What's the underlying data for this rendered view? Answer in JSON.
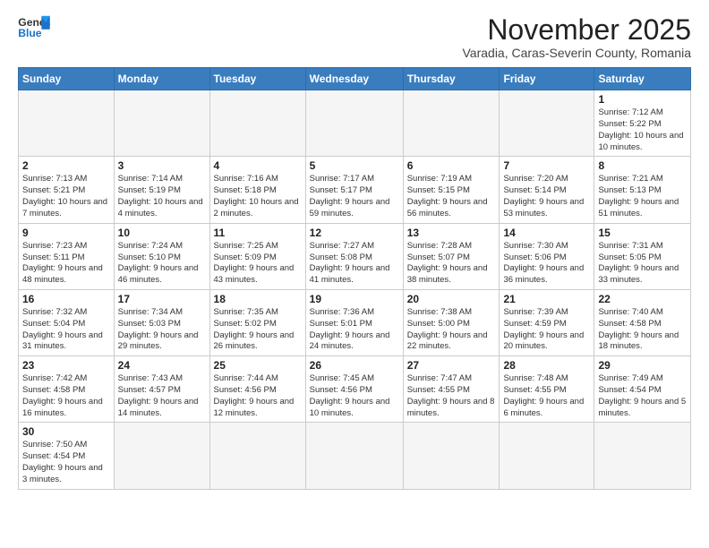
{
  "logo": {
    "line1": "General",
    "line2": "Blue"
  },
  "title": "November 2025",
  "subtitle": "Varadia, Caras-Severin County, Romania",
  "days_of_week": [
    "Sunday",
    "Monday",
    "Tuesday",
    "Wednesday",
    "Thursday",
    "Friday",
    "Saturday"
  ],
  "weeks": [
    [
      {
        "num": "",
        "info": "",
        "empty": true
      },
      {
        "num": "",
        "info": "",
        "empty": true
      },
      {
        "num": "",
        "info": "",
        "empty": true
      },
      {
        "num": "",
        "info": "",
        "empty": true
      },
      {
        "num": "",
        "info": "",
        "empty": true
      },
      {
        "num": "",
        "info": "",
        "empty": true
      },
      {
        "num": "1",
        "info": "Sunrise: 7:12 AM\nSunset: 5:22 PM\nDaylight: 10 hours\nand 10 minutes.",
        "empty": false
      }
    ],
    [
      {
        "num": "2",
        "info": "Sunrise: 7:13 AM\nSunset: 5:21 PM\nDaylight: 10 hours\nand 7 minutes.",
        "empty": false
      },
      {
        "num": "3",
        "info": "Sunrise: 7:14 AM\nSunset: 5:19 PM\nDaylight: 10 hours\nand 4 minutes.",
        "empty": false
      },
      {
        "num": "4",
        "info": "Sunrise: 7:16 AM\nSunset: 5:18 PM\nDaylight: 10 hours\nand 2 minutes.",
        "empty": false
      },
      {
        "num": "5",
        "info": "Sunrise: 7:17 AM\nSunset: 5:17 PM\nDaylight: 9 hours\nand 59 minutes.",
        "empty": false
      },
      {
        "num": "6",
        "info": "Sunrise: 7:19 AM\nSunset: 5:15 PM\nDaylight: 9 hours\nand 56 minutes.",
        "empty": false
      },
      {
        "num": "7",
        "info": "Sunrise: 7:20 AM\nSunset: 5:14 PM\nDaylight: 9 hours\nand 53 minutes.",
        "empty": false
      },
      {
        "num": "8",
        "info": "Sunrise: 7:21 AM\nSunset: 5:13 PM\nDaylight: 9 hours\nand 51 minutes.",
        "empty": false
      }
    ],
    [
      {
        "num": "9",
        "info": "Sunrise: 7:23 AM\nSunset: 5:11 PM\nDaylight: 9 hours\nand 48 minutes.",
        "empty": false
      },
      {
        "num": "10",
        "info": "Sunrise: 7:24 AM\nSunset: 5:10 PM\nDaylight: 9 hours\nand 46 minutes.",
        "empty": false
      },
      {
        "num": "11",
        "info": "Sunrise: 7:25 AM\nSunset: 5:09 PM\nDaylight: 9 hours\nand 43 minutes.",
        "empty": false
      },
      {
        "num": "12",
        "info": "Sunrise: 7:27 AM\nSunset: 5:08 PM\nDaylight: 9 hours\nand 41 minutes.",
        "empty": false
      },
      {
        "num": "13",
        "info": "Sunrise: 7:28 AM\nSunset: 5:07 PM\nDaylight: 9 hours\nand 38 minutes.",
        "empty": false
      },
      {
        "num": "14",
        "info": "Sunrise: 7:30 AM\nSunset: 5:06 PM\nDaylight: 9 hours\nand 36 minutes.",
        "empty": false
      },
      {
        "num": "15",
        "info": "Sunrise: 7:31 AM\nSunset: 5:05 PM\nDaylight: 9 hours\nand 33 minutes.",
        "empty": false
      }
    ],
    [
      {
        "num": "16",
        "info": "Sunrise: 7:32 AM\nSunset: 5:04 PM\nDaylight: 9 hours\nand 31 minutes.",
        "empty": false
      },
      {
        "num": "17",
        "info": "Sunrise: 7:34 AM\nSunset: 5:03 PM\nDaylight: 9 hours\nand 29 minutes.",
        "empty": false
      },
      {
        "num": "18",
        "info": "Sunrise: 7:35 AM\nSunset: 5:02 PM\nDaylight: 9 hours\nand 26 minutes.",
        "empty": false
      },
      {
        "num": "19",
        "info": "Sunrise: 7:36 AM\nSunset: 5:01 PM\nDaylight: 9 hours\nand 24 minutes.",
        "empty": false
      },
      {
        "num": "20",
        "info": "Sunrise: 7:38 AM\nSunset: 5:00 PM\nDaylight: 9 hours\nand 22 minutes.",
        "empty": false
      },
      {
        "num": "21",
        "info": "Sunrise: 7:39 AM\nSunset: 4:59 PM\nDaylight: 9 hours\nand 20 minutes.",
        "empty": false
      },
      {
        "num": "22",
        "info": "Sunrise: 7:40 AM\nSunset: 4:58 PM\nDaylight: 9 hours\nand 18 minutes.",
        "empty": false
      }
    ],
    [
      {
        "num": "23",
        "info": "Sunrise: 7:42 AM\nSunset: 4:58 PM\nDaylight: 9 hours\nand 16 minutes.",
        "empty": false
      },
      {
        "num": "24",
        "info": "Sunrise: 7:43 AM\nSunset: 4:57 PM\nDaylight: 9 hours\nand 14 minutes.",
        "empty": false
      },
      {
        "num": "25",
        "info": "Sunrise: 7:44 AM\nSunset: 4:56 PM\nDaylight: 9 hours\nand 12 minutes.",
        "empty": false
      },
      {
        "num": "26",
        "info": "Sunrise: 7:45 AM\nSunset: 4:56 PM\nDaylight: 9 hours\nand 10 minutes.",
        "empty": false
      },
      {
        "num": "27",
        "info": "Sunrise: 7:47 AM\nSunset: 4:55 PM\nDaylight: 9 hours\nand 8 minutes.",
        "empty": false
      },
      {
        "num": "28",
        "info": "Sunrise: 7:48 AM\nSunset: 4:55 PM\nDaylight: 9 hours\nand 6 minutes.",
        "empty": false
      },
      {
        "num": "29",
        "info": "Sunrise: 7:49 AM\nSunset: 4:54 PM\nDaylight: 9 hours\nand 5 minutes.",
        "empty": false
      }
    ],
    [
      {
        "num": "30",
        "info": "Sunrise: 7:50 AM\nSunset: 4:54 PM\nDaylight: 9 hours\nand 3 minutes.",
        "empty": false
      },
      {
        "num": "",
        "info": "",
        "empty": true
      },
      {
        "num": "",
        "info": "",
        "empty": true
      },
      {
        "num": "",
        "info": "",
        "empty": true
      },
      {
        "num": "",
        "info": "",
        "empty": true
      },
      {
        "num": "",
        "info": "",
        "empty": true
      },
      {
        "num": "",
        "info": "",
        "empty": true
      }
    ]
  ]
}
